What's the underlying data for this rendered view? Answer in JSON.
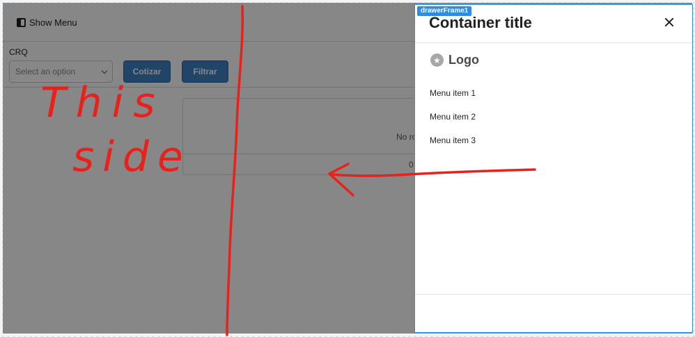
{
  "topbar": {
    "show_menu_label": "Show Menu"
  },
  "filters": {
    "crq_label": "CRQ",
    "select_placeholder": "Select an option",
    "cotizar_label": "Cotizar",
    "filtrar_label": "Filtrar"
  },
  "table": {
    "no_rows_text": "No ro",
    "footer_count": "0"
  },
  "drawer": {
    "frame_tag": "drawerFrame1",
    "title": "Container title",
    "logo_text": "Logo",
    "menu_items": [
      "Menu item 1",
      "Menu item 2",
      "Menu item 3"
    ]
  },
  "annotation": {
    "text_line1": "This",
    "text_line2": "side",
    "color": "#e8221b"
  },
  "colors": {
    "accent": "#3f80c6",
    "frame_blue": "#2b8de3"
  }
}
